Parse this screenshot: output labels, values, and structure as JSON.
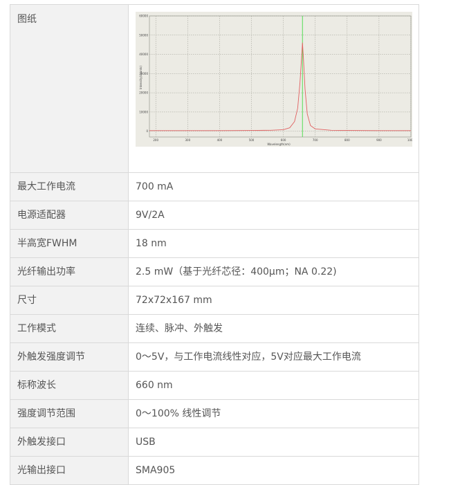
{
  "rows": [
    {
      "label": "图纸",
      "value": ""
    },
    {
      "label": "最大工作电流",
      "value": "700 mA"
    },
    {
      "label": "电源适配器",
      "value": "9V/2A"
    },
    {
      "label": "半高宽FWHM",
      "value": "18 nm"
    },
    {
      "label": "光纤输出功率",
      "value": "2.5 mW（基于光纤芯径：400μm；NA 0.22)"
    },
    {
      "label": "尺寸",
      "value": "72x72x167 mm"
    },
    {
      "label": "工作模式",
      "value": "连续、脉冲、外触发"
    },
    {
      "label": "外触发强度调节",
      "value": "0～5V，与工作电流线性对应，5V对应最大工作电流"
    },
    {
      "label": "标称波长",
      "value": "660 nm"
    },
    {
      "label": "强度调节范围",
      "value": "0～100% 线性调节"
    },
    {
      "label": "外触发接口",
      "value": "USB"
    },
    {
      "label": "光输出接口",
      "value": "SMA905"
    }
  ],
  "chart_data": {
    "type": "line",
    "xlabel": "Wavelength(nm)",
    "ylabel": "Intensity(counts)",
    "xlim": [
      180,
      1000
    ],
    "ylim": [
      -3000,
      60000
    ],
    "x_ticks": [
      "200",
      "300",
      "400",
      "500",
      "600",
      "700",
      "800",
      "900",
      "1000"
    ],
    "y_ticks": [
      "0",
      "10000",
      "20000",
      "30000",
      "40000",
      "50000",
      "60000"
    ],
    "grid": true,
    "marker_line_x": 660,
    "marker_line_color": "#55dd55",
    "line_color": "#e06060",
    "series": [
      {
        "x": [
          180,
          300,
          400,
          500,
          560,
          600,
          620,
          635,
          645,
          652,
          657,
          660,
          663,
          668,
          675,
          685,
          700,
          750,
          800,
          900,
          1000
        ],
        "y": [
          300,
          300,
          300,
          400,
          500,
          800,
          1800,
          5000,
          12000,
          25000,
          38000,
          46000,
          38000,
          22000,
          9000,
          3000,
          1200,
          500,
          400,
          300,
          300
        ]
      }
    ]
  }
}
